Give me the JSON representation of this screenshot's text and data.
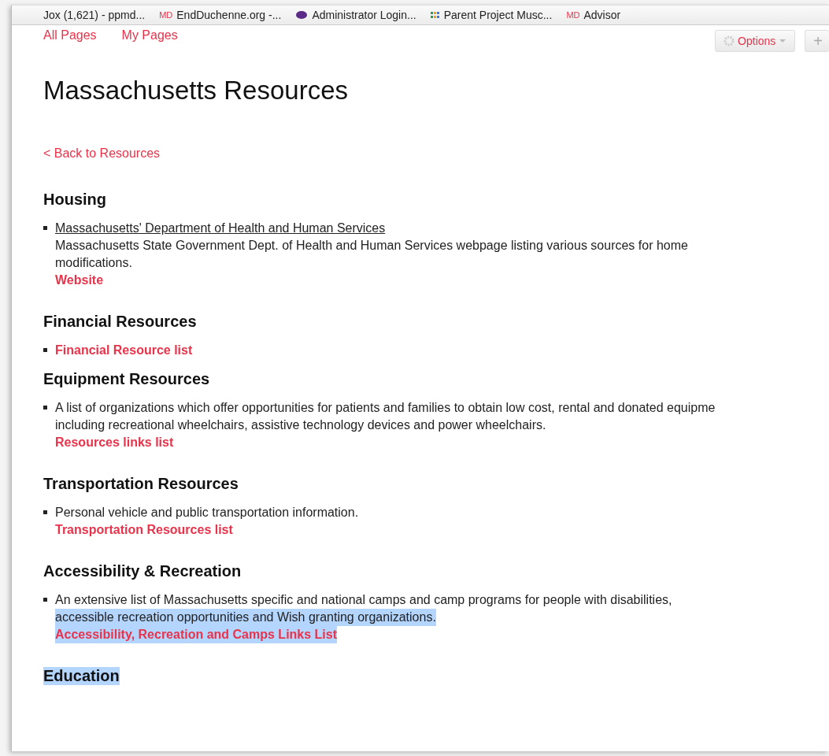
{
  "bookmarks": [
    {
      "text": "Jox (1,621) - ppmd...",
      "kind": "plain"
    },
    {
      "text": "EndDuchenne.org -...",
      "kind": "md",
      "badge": "MD"
    },
    {
      "text": "Administrator Login...",
      "kind": "logo"
    },
    {
      "text": "Parent Project Musc...",
      "kind": "grid"
    },
    {
      "text": "Advisor",
      "kind": "md",
      "badge": "MD"
    }
  ],
  "nav": [
    {
      "label": "All Pages"
    },
    {
      "label": "My Pages"
    }
  ],
  "toolbar": {
    "options": "Options",
    "add": "+"
  },
  "title": "Massachusetts Resources",
  "back_link": "< Back to Resources",
  "sections": [
    {
      "heading": "Housing",
      "highlighted": false,
      "items": [
        {
          "title": "Massachusetts' Department of Health and Human Services",
          "lines": [
            {
              "text": "Massachusetts State Government Dept. of Health and Human Services webpage listing various sources for home",
              "highlighted": false
            },
            {
              "text": "modifications.",
              "highlighted": false
            }
          ],
          "link": "Website",
          "link_highlighted": false
        }
      ]
    },
    {
      "heading": "Financial Resources",
      "highlighted": false,
      "items": [
        {
          "link": "Financial Resource list",
          "link_highlighted": false
        }
      ]
    },
    {
      "heading": "Equipment Resources",
      "highlighted": false,
      "items": [
        {
          "lines": [
            {
              "text": "A list of organizations which offer opportunities for patients and families to obtain low cost, rental and donated equipme",
              "highlighted": false
            },
            {
              "text": "including recreational wheelchairs, assistive technology devices and power wheelchairs.",
              "highlighted": false
            }
          ],
          "link": "Resources links list",
          "link_highlighted": false
        }
      ]
    },
    {
      "heading": "Transportation Resources",
      "highlighted": false,
      "items": [
        {
          "lines": [
            {
              "text": "Personal vehicle and public transportation information.",
              "highlighted": false
            }
          ],
          "link": "Transportation Resources list",
          "link_highlighted": false
        }
      ]
    },
    {
      "heading": "Accessibility & Recreation",
      "highlighted": false,
      "items": [
        {
          "lines": [
            {
              "text": "An extensive list of Massachusetts specific and national camps and camp programs for people with disabilities,",
              "highlighted": false
            },
            {
              "text": "accessible recreation opportunities and Wish granting organizations.",
              "highlighted": true
            }
          ],
          "link": "Accessibility, Recreation and Camps Links List",
          "link_highlighted": true
        }
      ]
    },
    {
      "heading": "Education",
      "highlighted": true
    }
  ]
}
